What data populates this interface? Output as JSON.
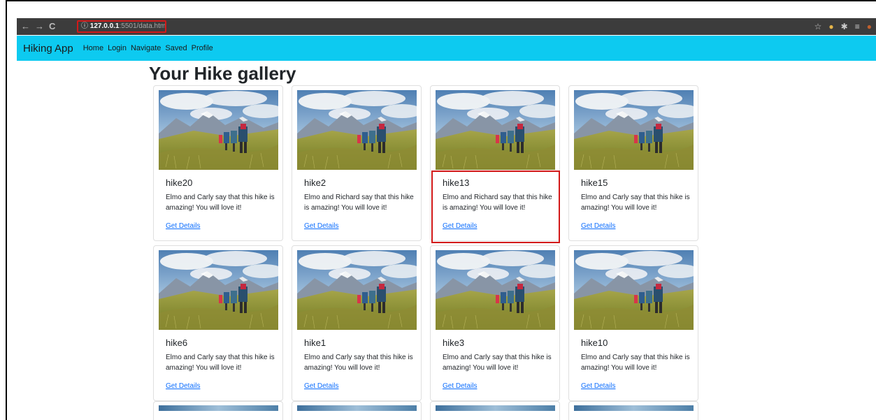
{
  "browser": {
    "url_host": "127.0.0.1",
    "url_port_path": ":5501/data.html"
  },
  "navbar": {
    "brand": "Hiking App",
    "links": [
      "Home",
      "Login",
      "Navigate",
      "Saved",
      "Profile"
    ]
  },
  "page": {
    "heading": "Your Hike gallery"
  },
  "cards": [
    {
      "title": "hike20",
      "text": "Elmo and Carly say that this hike is amazing! You will love it!",
      "link": "Get Details"
    },
    {
      "title": "hike2",
      "text": "Elmo and Richard say that this hike is amazing! You will love it!",
      "link": "Get Details"
    },
    {
      "title": "hike13",
      "text": "Elmo and Richard say that this hike is amazing! You will love it!",
      "link": "Get Details"
    },
    {
      "title": "hike15",
      "text": "Elmo and Carly say that this hike is amazing! You will love it!",
      "link": "Get Details"
    },
    {
      "title": "hike6",
      "text": "Elmo and Carly say that this hike is amazing! You will love it!",
      "link": "Get Details"
    },
    {
      "title": "hike1",
      "text": "Elmo and Carly say that this hike is amazing! You will love it!",
      "link": "Get Details"
    },
    {
      "title": "hike3",
      "text": "Elmo and Carly say that this hike is amazing! You will love it!",
      "link": "Get Details"
    },
    {
      "title": "hike10",
      "text": "Elmo and Carly say that this hike is amazing! You will love it!",
      "link": "Get Details"
    }
  ],
  "colors": {
    "navbar": "#0dcaf0",
    "link": "#0d6efd",
    "highlight": "#d21919",
    "chrome": "#3c3c3c"
  }
}
